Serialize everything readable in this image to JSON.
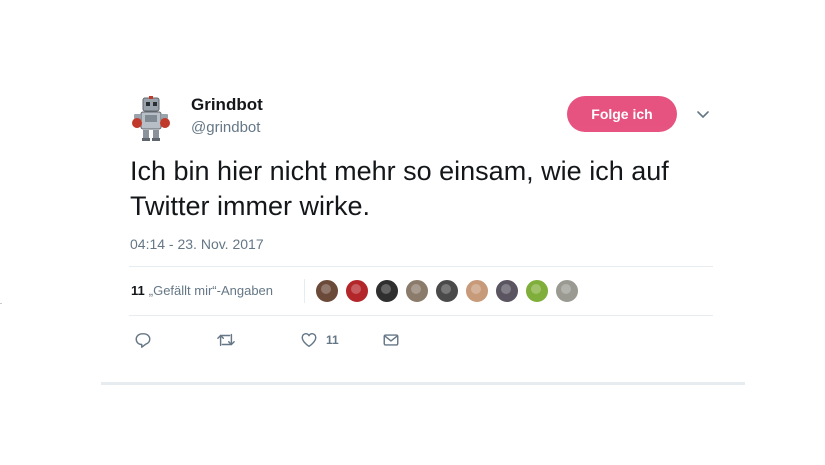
{
  "user": {
    "name": "Grindbot",
    "handle": "@grindbot",
    "avatar": "robot-avatar"
  },
  "follow_button": {
    "label": "Folge ich",
    "color": "#e0245e"
  },
  "tweet": {
    "text": "Ich bin hier nicht mehr so einsam, wie ich auf Twitter immer wirke.",
    "timestamp": "04:14 - 23. Nov. 2017"
  },
  "stats": {
    "likes_count": "11",
    "likes_label": "„Gefällt mir“-Angaben",
    "liker_avatars": [
      {
        "icon": "liker-avatar-1",
        "color": "#6b4a3a"
      },
      {
        "icon": "liker-avatar-2",
        "color": "#b3262a"
      },
      {
        "icon": "liker-avatar-3",
        "color": "#2f2f2f"
      },
      {
        "icon": "liker-avatar-4",
        "color": "#8a7b6a"
      },
      {
        "icon": "liker-avatar-5",
        "color": "#4a4a4a"
      },
      {
        "icon": "liker-avatar-6",
        "color": "#c79a7a"
      },
      {
        "icon": "liker-avatar-7",
        "color": "#5a5560"
      },
      {
        "icon": "liker-avatar-8",
        "color": "#7fae3a"
      },
      {
        "icon": "liker-avatar-9",
        "color": "#9a9a92"
      }
    ]
  },
  "actions": {
    "reply_icon": "reply-icon",
    "retweet_icon": "retweet-icon",
    "like_icon": "heart-icon",
    "like_count": "11",
    "dm_icon": "envelope-icon"
  },
  "colors": {
    "text_primary": "#14171a",
    "text_secondary": "#657786",
    "divider": "#e6ecf0"
  }
}
